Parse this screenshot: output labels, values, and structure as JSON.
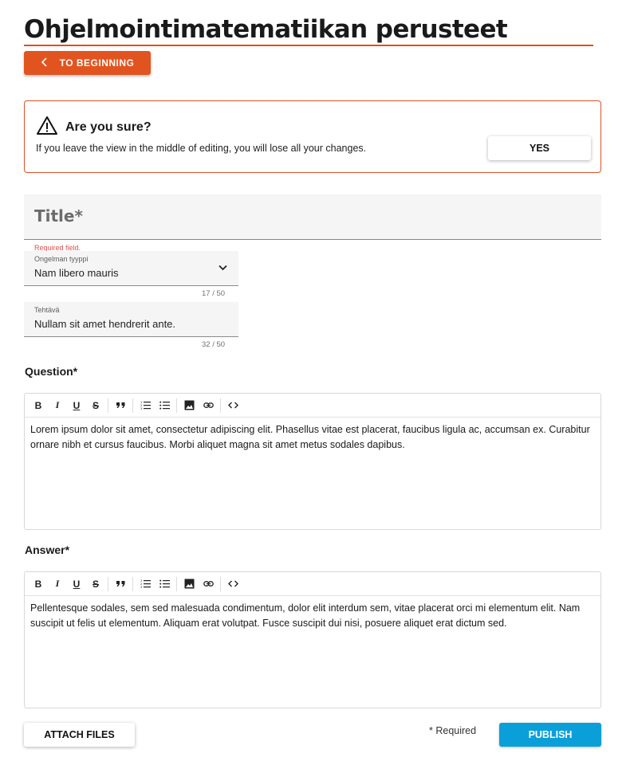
{
  "page": {
    "title": "Ohjelmointimatematiikan perusteet"
  },
  "back_button": {
    "label": "TO BEGINNING",
    "icon": "chevron-left-icon"
  },
  "warning": {
    "icon": "warning-triangle-icon",
    "title": "Are you sure?",
    "message": "If you leave the view in the middle of editing, you will lose all your changes.",
    "confirm_label": "YES",
    "border_color": "#d9542a"
  },
  "title_field": {
    "placeholder": "Title*",
    "error": "Required field."
  },
  "problem_type": {
    "label": "Ongelman tyyppi",
    "value": "Nam libero mauris",
    "counter": "17 / 50",
    "icon": "chevron-down-icon"
  },
  "task": {
    "label": "Tehtävä",
    "value": "Nullam sit amet hendrerit ante.",
    "counter": "32 / 50"
  },
  "question": {
    "label": "Question*",
    "text": "Lorem ipsum dolor sit amet, consectetur adipiscing elit. Phasellus vitae est placerat, faucibus ligula ac, accumsan ex. Curabitur ornare nibh et cursus faucibus. Morbi aliquet magna sit amet metus sodales dapibus."
  },
  "answer": {
    "label": "Answer*",
    "text": "Pellentesque sodales, sem sed malesuada condimentum, dolor elit interdum sem, vitae placerat orci mi elementum elit. Nam suscipit ut felis ut elementum. Aliquam erat volutpat. Fusce suscipit dui nisi, posuere aliquet erat dictum sed."
  },
  "toolbar": {
    "bold": "B",
    "italic": "I",
    "underline": "U",
    "strike": "S"
  },
  "footer": {
    "attach_label": "ATTACH FILES",
    "required_note": "*  Required",
    "publish_label": "PUBLISH"
  },
  "colors": {
    "accent": "#e2541f",
    "primary": "#0b9fd9",
    "error": "#e05050"
  }
}
